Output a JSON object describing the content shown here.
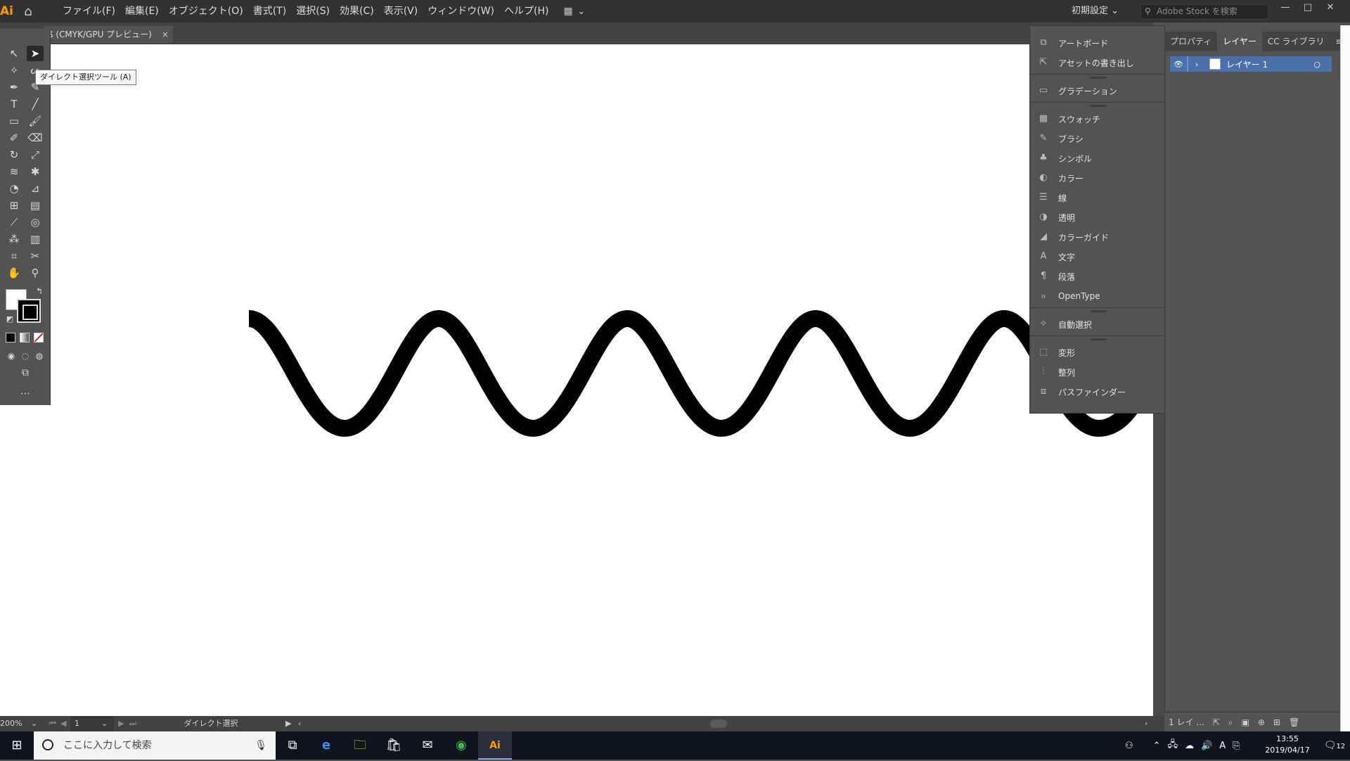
{
  "app": {
    "logo": "Ai",
    "menus": [
      "ファイル(F)",
      "編集(E)",
      "オブジェクト(O)",
      "書式(T)",
      "選択(S)",
      "効果(C)",
      "表示(V)",
      "ウィンドウ(W)",
      "ヘルプ(H)"
    ],
    "workspace": "初期設定",
    "stock_placeholder": "Adobe Stock を検索",
    "document_tab": "ß (CMYK/GPU プレビュー)",
    "tooltip": "ダイレクト選択ツール (A)"
  },
  "window_panel": {
    "groups": [
      [
        {
          "label": "アートボード",
          "icon": "artboard-icon"
        },
        {
          "label": "アセットの書き出し",
          "icon": "export-icon"
        }
      ],
      [
        {
          "label": "グラデーション",
          "icon": "gradient-icon"
        }
      ],
      [
        {
          "label": "スウォッチ",
          "icon": "swatches-icon"
        },
        {
          "label": "ブラシ",
          "icon": "brush-icon"
        },
        {
          "label": "シンボル",
          "icon": "symbol-icon"
        },
        {
          "label": "カラー",
          "icon": "color-icon"
        },
        {
          "label": "線",
          "icon": "stroke-icon"
        },
        {
          "label": "透明",
          "icon": "transparency-icon"
        },
        {
          "label": "カラーガイド",
          "icon": "color-guide-icon"
        },
        {
          "label": "文字",
          "icon": "character-icon"
        },
        {
          "label": "段落",
          "icon": "paragraph-icon"
        },
        {
          "label": "OpenType",
          "icon": "opentype-icon"
        }
      ],
      [
        {
          "label": "自動選択",
          "icon": "magic-wand-icon"
        }
      ],
      [
        {
          "label": "変形",
          "icon": "transform-icon"
        },
        {
          "label": "整列",
          "icon": "align-icon"
        },
        {
          "label": "パスファインダー",
          "icon": "pathfinder-icon"
        }
      ]
    ]
  },
  "right_panel": {
    "tabs": [
      "プロパティ",
      "レイヤー",
      "CC ライブラリ"
    ],
    "active_tab": "レイヤー",
    "layer_name": "レイヤー 1",
    "footer_label": "1 レイ ..."
  },
  "status": {
    "zoom": "200%",
    "artboard": "1",
    "tool": "ダイレクト選択"
  },
  "taskbar": {
    "search_placeholder": "ここに入力して検索",
    "time": "13:55",
    "date": "2019/04/17",
    "notifications": "12",
    "ime": "A"
  }
}
